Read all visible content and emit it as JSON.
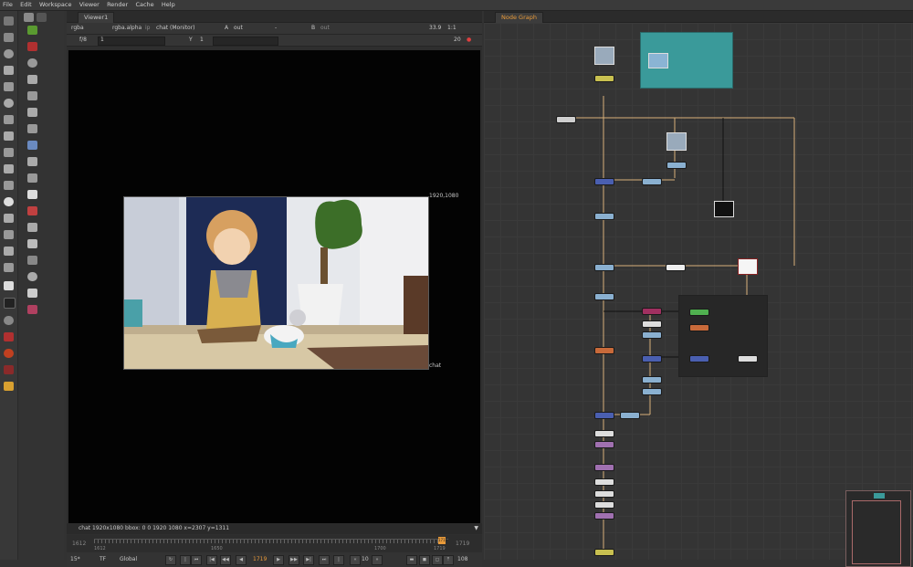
{
  "menu": [
    "File",
    "Edit",
    "Workspace",
    "Viewer",
    "Render",
    "Cache",
    "Help"
  ],
  "viewer": {
    "tab_label": "Viewer1",
    "channels": "rgba",
    "alpha_channel": "rgba.alpha",
    "ip_label": "ip",
    "display": "chat (Monitor)",
    "a_label": "A",
    "a_input": "out",
    "dash": "-",
    "b_label": "B",
    "b_input": "out",
    "zoom": "33.9",
    "ratio": "1:1",
    "fstop": "f/8",
    "gain": "1",
    "y_label": "Y",
    "gamma": "1",
    "frame_value": "20",
    "format_label": "1920,1080",
    "node_label": "chat",
    "status": "chat 1920x1080  bbox: 0 0 1920 1080   x=2307 y=1311",
    "timeline": {
      "start": "1612",
      "end": "1719",
      "ticks": [
        "1612",
        "1650",
        "1700",
        "1719"
      ],
      "current_marker": "1719"
    },
    "playbar": {
      "fps": "15*",
      "tf": "TF",
      "scope": "Global",
      "current_frame": "1719",
      "step": "10",
      "end_frame": "108"
    }
  },
  "node_graph": {
    "tab_label": "Node Graph"
  },
  "colors": {
    "accent": "#e89a3a",
    "backdrop": "#3a9a9a",
    "wire": "#d9b07a"
  }
}
